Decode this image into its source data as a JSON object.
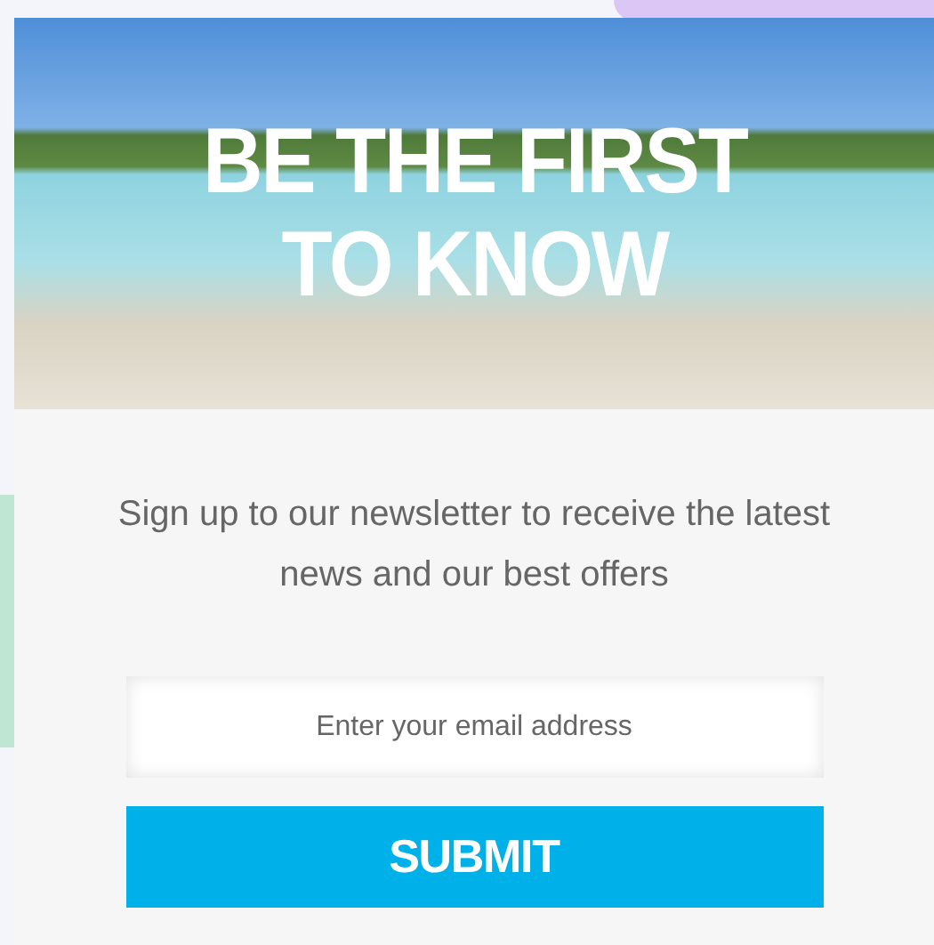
{
  "headline": [
    "BE THE FIRST",
    "TO KNOW"
  ],
  "description": "Sign up to our newsletter to receive the latest news and our best offers",
  "email_field": {
    "placeholder": "Enter your email address"
  },
  "submit_button": {
    "label": "SUBMIT"
  }
}
